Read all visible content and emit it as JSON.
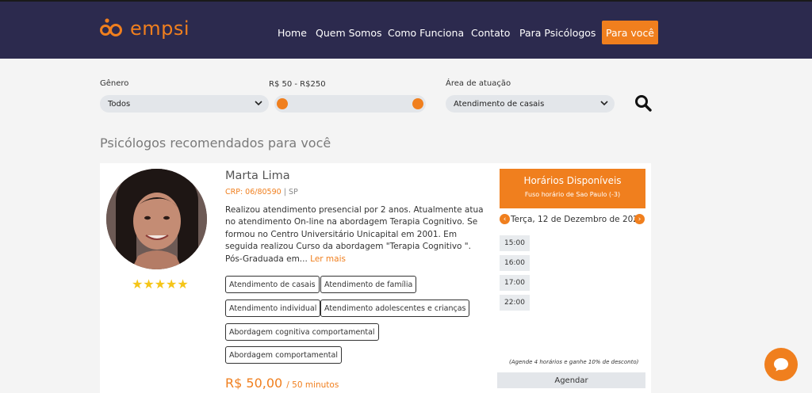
{
  "header": {
    "logo_text": "empsi",
    "nav": [
      "Home",
      "Quem Somos",
      "Como Funciona",
      "Contato",
      "Para Psicólogos"
    ],
    "cta": "Para você"
  },
  "filters": {
    "gender": {
      "label": "Gênero",
      "value": "Todos"
    },
    "price": {
      "label": "R$ 50 - R$250",
      "min": 50,
      "max": 250
    },
    "area": {
      "label": "Área de atuação",
      "value": "Atendimento de casais"
    }
  },
  "section_title": "Psicólogos recomendados para você",
  "psychologist": {
    "name": "Marta Lima",
    "crp_label": "CRP: 06/80590",
    "state": "SP",
    "bio": "Realizou atendimento presencial por 2 anos. Atualmente atua no atendimento On-line na abordagem Terapia Cognitivo. Se formou no Centro Universitário Unicapital em 2001. Em seguida realizou Curso da abordagem \"Terapia Cognitivo \". Pós-Graduada em...",
    "read_more": "Ler mais",
    "rating": 5,
    "stars": "★★★★★",
    "tags": [
      "Atendimento de casais",
      "Atendimento de família",
      "Atendimento individual",
      "Atendimento adolescentes e crianças",
      "Abordagem cognitiva comportamental",
      "Abordagem comportamental"
    ],
    "price": "R$ 50,00",
    "duration": "/ 50 minutos"
  },
  "schedule": {
    "title": "Horários Disponíveis",
    "timezone": "Fuso horário de Sao Paulo (-3)",
    "date": "Terça, 12 de Dezembro de 2023",
    "slots": [
      "15:00",
      "16:00",
      "17:00",
      "22:00"
    ],
    "promo": "(Agende 4 horários e ganhe 10% de desconto)",
    "button": "Agendar"
  },
  "colors": {
    "header_bg": "#2c2a4e",
    "accent": "#f07f1e",
    "page_bg": "#f4f4f4"
  },
  "icons": [
    "logo-icon",
    "chevron-down-icon",
    "search-icon",
    "chevron-left-icon",
    "chevron-right-icon",
    "chat-bubble-icon",
    "star-icon"
  ]
}
